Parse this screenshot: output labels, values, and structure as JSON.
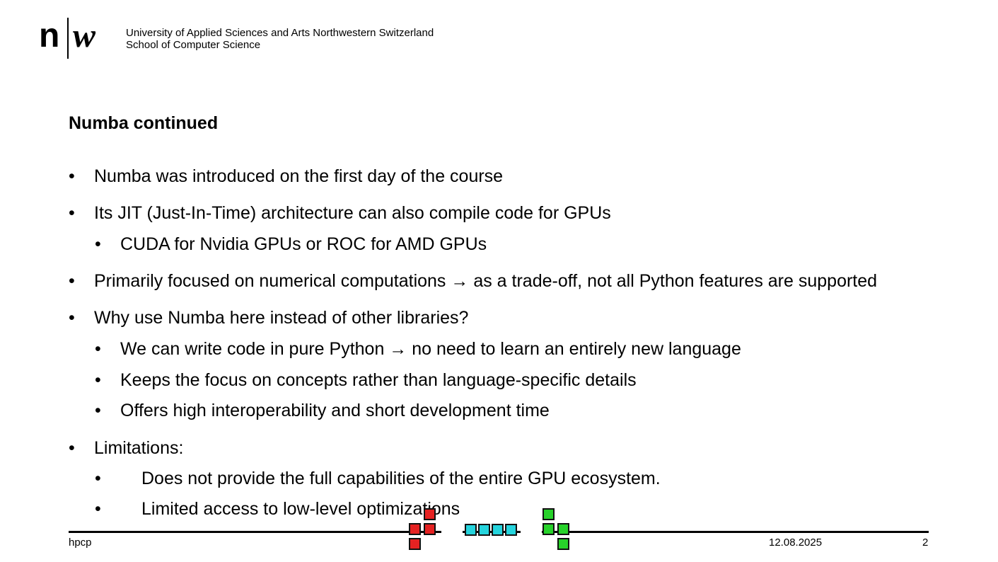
{
  "header": {
    "logo_n": "n",
    "logo_w": "w",
    "institution_line1": "University of Applied Sciences and Arts Northwestern Switzerland",
    "institution_line2": "School of Computer Science"
  },
  "slide": {
    "title": "Numba continued",
    "bullet_symbol": "•",
    "items": [
      {
        "level": 1,
        "text": "Numba was introduced on the first day of the course"
      },
      {
        "level": 1,
        "text": "Its JIT (Just-In-Time) architecture can also compile code for GPUs"
      },
      {
        "level": 2,
        "text": "CUDA for Nvidia GPUs or ROC for AMD GPUs"
      },
      {
        "level": 1,
        "text": "Primarily focused on numerical computations → as a trade-off, not all Python features are supported"
      },
      {
        "level": 1,
        "text": "Why use Numba here instead of other libraries?"
      },
      {
        "level": 2,
        "text": "We can write code in pure Python → no need to learn an entirely new language"
      },
      {
        "level": 2,
        "text": "Keeps the focus on concepts rather than language-specific details"
      },
      {
        "level": 2,
        "text": "Offers high interoperability and short development time"
      },
      {
        "level": 1,
        "text": "Limitations:"
      },
      {
        "level": 2,
        "text": "Does not provide the full capabilities of the entire GPU ecosystem."
      },
      {
        "level": 2,
        "text": "Limited access to low-level optimizations"
      }
    ]
  },
  "footer": {
    "left": "hpcp",
    "date": "12.08.2025",
    "page": "2"
  },
  "colors": {
    "red_block": "#e52222",
    "cyan_block": "#25d4dd",
    "green_block": "#27d22a"
  }
}
